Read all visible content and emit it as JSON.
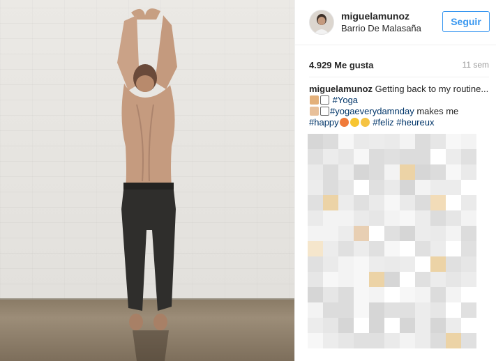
{
  "post": {
    "username": "miguelamunoz",
    "location": "Barrio De Malasaña",
    "follow_label": "Seguir",
    "likes": "4.929 Me gusta",
    "time_ago": "11 sem"
  },
  "caption": {
    "author": "miguelamunoz",
    "text_1": "Getting back to my routine...",
    "tag_yoga": "#Yoga",
    "tag_yogaeverydamnday": "#yogaeverydamnday",
    "text_2": "makes me",
    "tag_happy": "#happy",
    "tag_feliz": "#feliz",
    "tag_heureux": "#heureux"
  },
  "colors": {
    "link_blue": "#3897f0",
    "hashtag": "#003569",
    "muted": "#999999"
  },
  "icons": {
    "emoji_1": "praying-hands-emoji",
    "emoji_2": "grid-emoji",
    "emoji_3": "raising-hands-emoji",
    "emoji_4": "explosion-emoji",
    "emoji_5": "sun-emoji",
    "emoji_6": "smile-emoji"
  }
}
